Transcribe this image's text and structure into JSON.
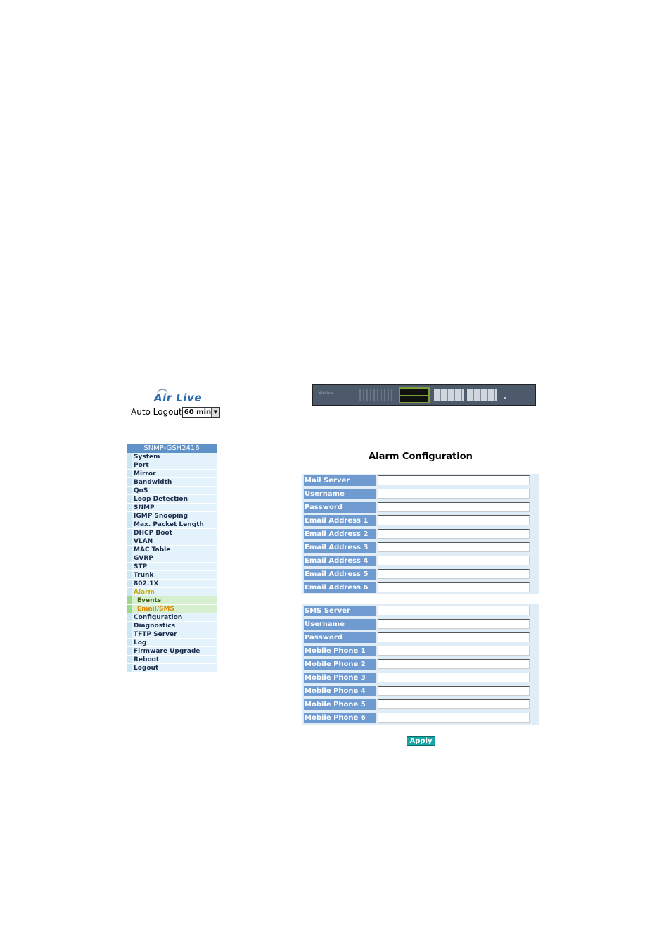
{
  "header": {
    "logo_text": "Air Live",
    "auto_logout_label": "Auto Logout",
    "auto_logout_value": "60 min"
  },
  "menu": {
    "header": "SNMP-GSH2416",
    "items": [
      "System",
      "Port",
      "Mirror",
      "Bandwidth",
      "QoS",
      "Loop Detection",
      "SNMP",
      "IGMP Snooping",
      "Max. Packet Length",
      "DHCP Boot",
      "VLAN",
      "MAC Table",
      "GVRP",
      "STP",
      "Trunk",
      "802.1X",
      "Alarm",
      "Events",
      "Email/SMS",
      "Configuration",
      "Diagnostics",
      "TFTP Server",
      "Log",
      "Firmware Upgrade",
      "Reboot",
      "Logout"
    ]
  },
  "main": {
    "title": "Alarm Configuration",
    "email_rows": [
      "Mail Server",
      "Username",
      "Password",
      "Email Address 1",
      "Email Address 2",
      "Email Address 3",
      "Email Address 4",
      "Email Address 5",
      "Email Address 6"
    ],
    "sms_rows": [
      "SMS Server",
      "Username",
      "Password",
      "Mobile Phone 1",
      "Mobile Phone 2",
      "Mobile Phone 3",
      "Mobile Phone 4",
      "Mobile Phone 5",
      "Mobile Phone 6"
    ],
    "apply_label": "Apply"
  }
}
